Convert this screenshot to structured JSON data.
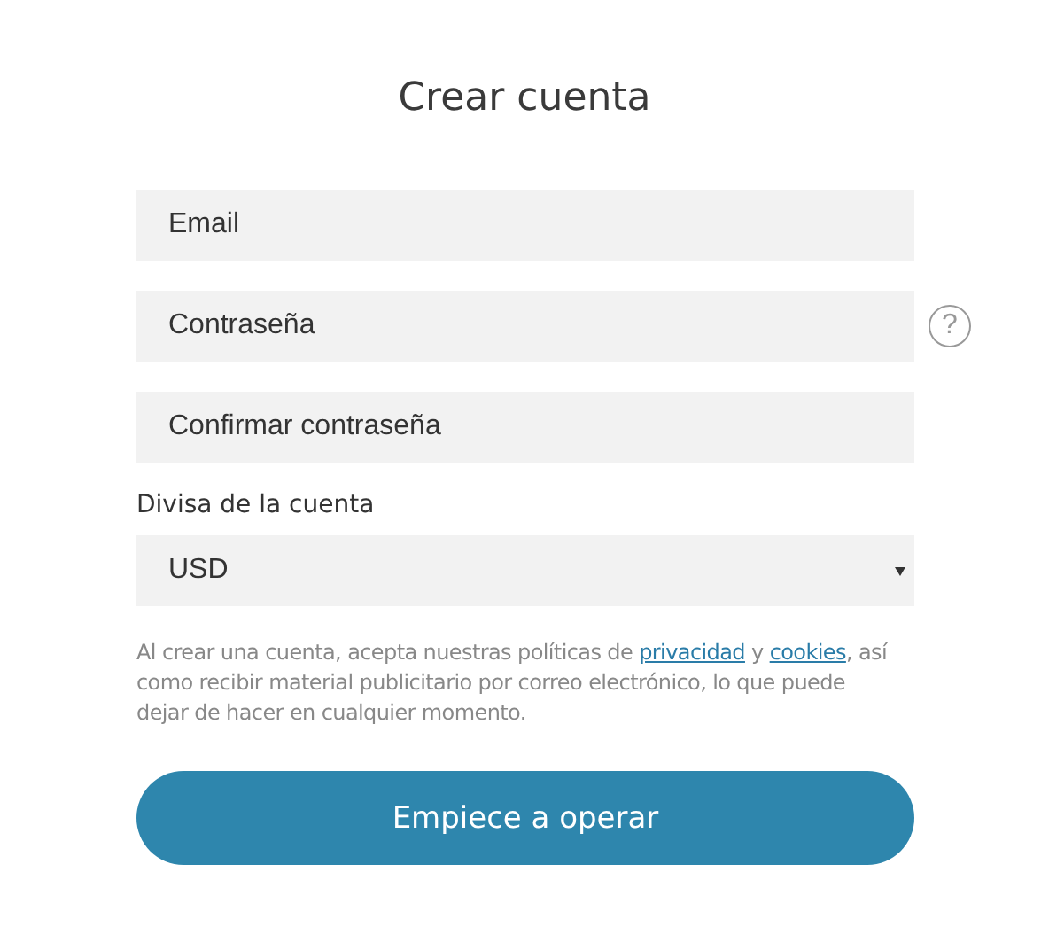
{
  "title": "Crear cuenta",
  "fields": [
    {
      "placeholder": "Email"
    },
    {
      "placeholder": "Contraseña",
      "help": "?"
    },
    {
      "placeholder": "Confirmar contraseña"
    }
  ],
  "currency": {
    "label": "Divisa de la cuenta",
    "value": "USD"
  },
  "consent": [
    {
      "kind": "text",
      "text": "Al crear una cuenta, acepta nuestras políticas de "
    },
    {
      "kind": "link",
      "text": "privacidad"
    },
    {
      "kind": "text",
      "text": " y "
    },
    {
      "kind": "link",
      "text": "cookies"
    },
    {
      "kind": "text",
      "text": ", así como recibir material publicitario por correo electrónico, lo que puede dejar de hacer en cualquier momento."
    }
  ],
  "submit": "Empiece a operar"
}
